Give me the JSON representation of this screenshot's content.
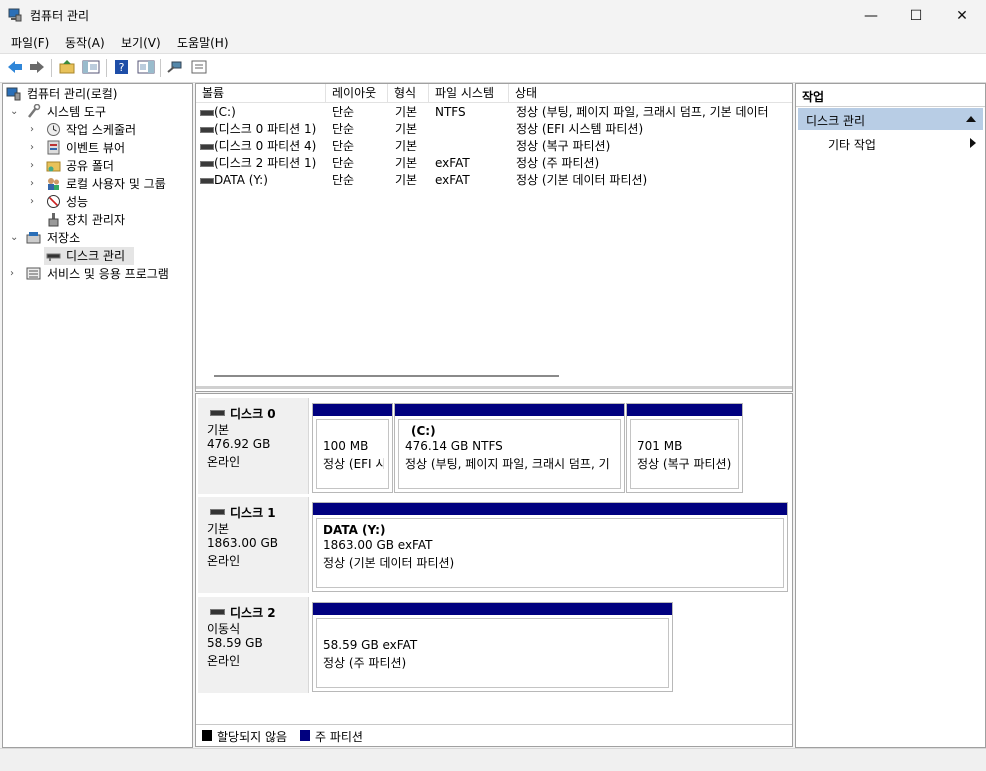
{
  "window": {
    "title": "컴퓨터 관리",
    "minimize": "—",
    "maximize": "☐",
    "close": "✕"
  },
  "menu": [
    "파일(F)",
    "동작(A)",
    "보기(V)",
    "도움말(H)"
  ],
  "tree": {
    "items": [
      {
        "label": "컴퓨터 관리(로컬)",
        "icon": "computer-icon"
      },
      {
        "label": "시스템 도구",
        "icon": "tools-icon",
        "expanded": true
      },
      {
        "label": "작업 스케줄러",
        "icon": "clock-icon"
      },
      {
        "label": "이벤트 뷰어",
        "icon": "event-viewer-icon"
      },
      {
        "label": "공유 폴더",
        "icon": "shared-folder-icon"
      },
      {
        "label": "로컬 사용자 및 그룹",
        "icon": "users-icon"
      },
      {
        "label": "성능",
        "icon": "performance-icon"
      },
      {
        "label": "장치 관리자",
        "icon": "device-manager-icon"
      },
      {
        "label": "저장소",
        "icon": "storage-icon",
        "expanded": true
      },
      {
        "label": "디스크 관리",
        "icon": "disk-icon",
        "selected": true
      },
      {
        "label": "서비스 및 응용 프로그램",
        "icon": "services-icon"
      }
    ]
  },
  "volume_list": {
    "headers": [
      "볼륨",
      "레이아웃",
      "형식",
      "파일 시스템",
      "상태"
    ],
    "rows": [
      {
        "volume": "(C:)",
        "layout": "단순",
        "type": "기본",
        "fs": "NTFS",
        "status": "정상 (부팅, 페이지 파일, 크래시 덤프, 기본 데이터"
      },
      {
        "volume": "(디스크 0 파티션 1)",
        "layout": "단순",
        "type": "기본",
        "fs": "",
        "status": "정상 (EFI 시스템 파티션)"
      },
      {
        "volume": "(디스크 0 파티션 4)",
        "layout": "단순",
        "type": "기본",
        "fs": "",
        "status": "정상 (복구 파티션)"
      },
      {
        "volume": "(디스크 2 파티션 1)",
        "layout": "단순",
        "type": "기본",
        "fs": "exFAT",
        "status": "정상 (주 파티션)"
      },
      {
        "volume": "DATA (Y:)",
        "layout": "단순",
        "type": "기본",
        "fs": "exFAT",
        "status": "정상 (기본 데이터 파티션)"
      }
    ]
  },
  "disks": [
    {
      "name": "디스크 0",
      "kind": "기본",
      "size": "476.92 GB",
      "state": "온라인",
      "partitions": [
        {
          "title": "",
          "line1": "100 MB",
          "line2": "정상 (EFI 시:"
        },
        {
          "title": "(C:)",
          "line1": "476.14 GB NTFS",
          "line2": "정상 (부팅, 페이지 파일, 크래시 덤프, 기"
        },
        {
          "title": "",
          "line1": "701 MB",
          "line2": "정상 (복구 파티션)"
        }
      ]
    },
    {
      "name": "디스크 1",
      "kind": "기본",
      "size": "1863.00 GB",
      "state": "온라인",
      "partitions": [
        {
          "title": "DATA  (Y:)",
          "line1": "1863.00 GB exFAT",
          "line2": "정상 (기본 데이터 파티션)"
        }
      ]
    },
    {
      "name": "디스크 2",
      "kind": "이동식",
      "size": "58.59 GB",
      "state": "온라인",
      "partitions": [
        {
          "title": "",
          "line1": "58.59 GB exFAT",
          "line2": "정상 (주 파티션)"
        }
      ]
    }
  ],
  "legend": [
    {
      "label": "할당되지 않음",
      "color": "#000000"
    },
    {
      "label": "주 파티션",
      "color": "#00007f"
    }
  ],
  "actions": {
    "header": "작업",
    "section": "디스크 관리",
    "item": "기타 작업"
  }
}
